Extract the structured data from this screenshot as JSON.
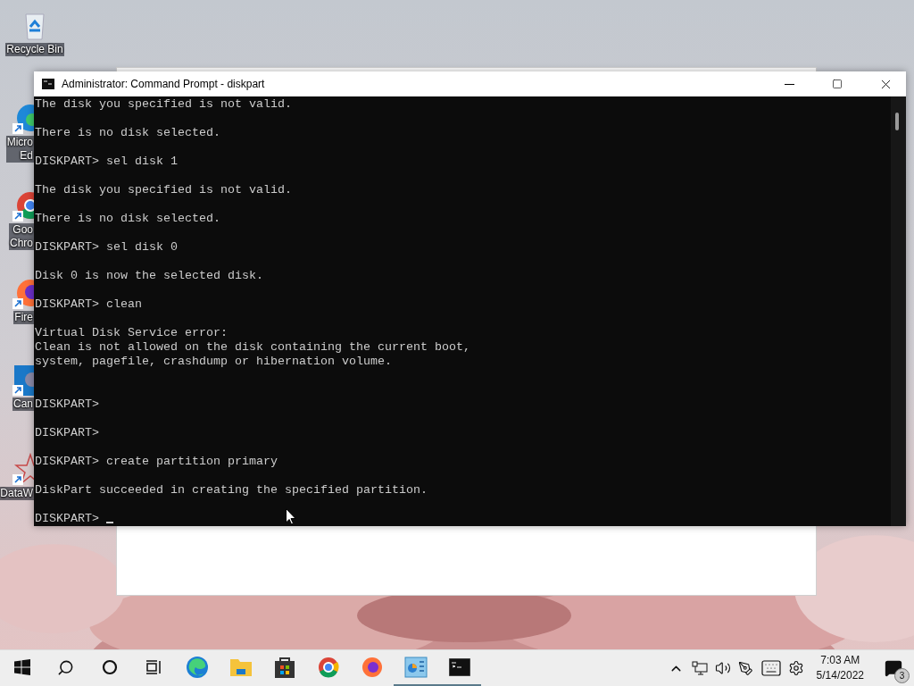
{
  "desktop": {
    "icons": [
      {
        "kind": "recycle-bin",
        "label_lines": [
          "Recycle Bin"
        ],
        "shortcut": false,
        "covered": false
      },
      {
        "kind": "edge",
        "label_lines": [
          "Micro",
          "Ed"
        ],
        "shortcut": true,
        "covered": true
      },
      {
        "kind": "chrome",
        "label_lines": [
          "Goo",
          "Chro"
        ],
        "shortcut": true,
        "covered": true
      },
      {
        "kind": "firefox",
        "label_lines": [
          "Fire"
        ],
        "shortcut": true,
        "covered": true
      },
      {
        "kind": "camera",
        "label_lines": [
          "Can"
        ],
        "shortcut": true,
        "covered": true
      },
      {
        "kind": "star",
        "label_lines": [
          "DataW"
        ],
        "shortcut": true,
        "covered": true
      }
    ]
  },
  "console_window": {
    "title": "Administrator: Command Prompt - diskpart",
    "lines": [
      {
        "kind": "text",
        "text": "The disk you specified is not valid."
      },
      {
        "kind": "blank"
      },
      {
        "kind": "text",
        "text": "There is no disk selected."
      },
      {
        "kind": "blank"
      },
      {
        "kind": "text",
        "text": "DISKPART> sel disk 1"
      },
      {
        "kind": "blank"
      },
      {
        "kind": "text",
        "text": "The disk you specified is not valid."
      },
      {
        "kind": "blank"
      },
      {
        "kind": "text",
        "text": "There is no disk selected."
      },
      {
        "kind": "blank"
      },
      {
        "kind": "text",
        "text": "DISKPART> sel disk 0"
      },
      {
        "kind": "blank"
      },
      {
        "kind": "text",
        "text": "Disk 0 is now the selected disk."
      },
      {
        "kind": "blank"
      },
      {
        "kind": "text",
        "text": "DISKPART> clean"
      },
      {
        "kind": "blank"
      },
      {
        "kind": "text",
        "text": "Virtual Disk Service error:"
      },
      {
        "kind": "text",
        "text": "Clean is not allowed on the disk containing the current boot,"
      },
      {
        "kind": "text",
        "text": "system, pagefile, crashdump or hibernation volume."
      },
      {
        "kind": "blank"
      },
      {
        "kind": "blank"
      },
      {
        "kind": "text",
        "text": "DISKPART>"
      },
      {
        "kind": "blank"
      },
      {
        "kind": "text",
        "text": "DISKPART>"
      },
      {
        "kind": "blank"
      },
      {
        "kind": "text",
        "text": "DISKPART> create partition primary"
      },
      {
        "kind": "blank"
      },
      {
        "kind": "text",
        "text": "DiskPart succeeded in creating the specified partition."
      },
      {
        "kind": "blank"
      },
      {
        "kind": "input",
        "text": "DISKPART>"
      }
    ]
  },
  "taskbar": {
    "buttons": [
      {
        "kind": "start",
        "running": false
      },
      {
        "kind": "search",
        "running": false
      },
      {
        "kind": "cortana",
        "running": false
      },
      {
        "kind": "task-view",
        "running": false
      },
      {
        "kind": "edge",
        "running": false
      },
      {
        "kind": "folder",
        "running": false
      },
      {
        "kind": "store",
        "running": false
      },
      {
        "kind": "chrome",
        "running": false
      },
      {
        "kind": "firefox",
        "running": false
      },
      {
        "kind": "control-panel",
        "running": true
      },
      {
        "kind": "terminal",
        "running": true
      }
    ],
    "tray": [
      {
        "kind": "chevron"
      },
      {
        "kind": "network"
      },
      {
        "kind": "volume"
      },
      {
        "kind": "pen"
      },
      {
        "kind": "keyboard"
      },
      {
        "kind": "settings"
      }
    ],
    "clock": {
      "time": "7:03 AM",
      "date": "5/14/2022"
    },
    "notifications": {
      "count": "3"
    }
  }
}
